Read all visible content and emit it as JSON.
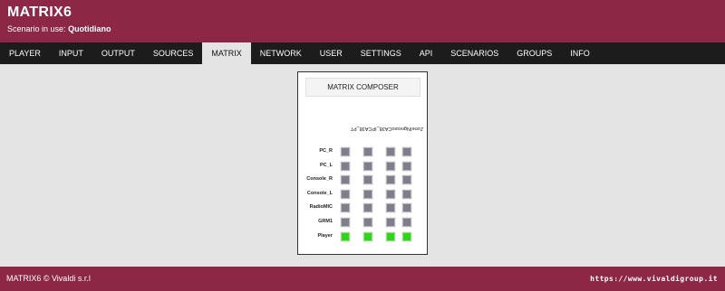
{
  "header": {
    "app_title": "MATRIX6",
    "scenario_label": "Scenario in use:",
    "scenario_value": "Quotidiano"
  },
  "nav": {
    "items": [
      {
        "label": "PLAYER"
      },
      {
        "label": "INPUT"
      },
      {
        "label": "OUTPUT"
      },
      {
        "label": "SOURCES"
      },
      {
        "label": "MATRIX",
        "active": true
      },
      {
        "label": "NETWORK"
      },
      {
        "label": "USER"
      },
      {
        "label": "SETTINGS"
      },
      {
        "label": "API"
      },
      {
        "label": "SCENARIOS"
      },
      {
        "label": "GROUPS"
      },
      {
        "label": "INFO"
      }
    ]
  },
  "matrix": {
    "composer_label": "MATRIX COMPOSER",
    "column_header": "ZoneINgressoCA38_IPCA38_PT",
    "rows": [
      {
        "label": "PC_R",
        "states": [
          false,
          false,
          false,
          false
        ]
      },
      {
        "label": "PC_L",
        "states": [
          false,
          false,
          false,
          false
        ]
      },
      {
        "label": "Console_R",
        "states": [
          false,
          false,
          false,
          false
        ]
      },
      {
        "label": "Console_L",
        "states": [
          false,
          false,
          false,
          false
        ]
      },
      {
        "label": "RadioMIC",
        "states": [
          false,
          false,
          false,
          false
        ]
      },
      {
        "label": "GRM1",
        "states": [
          false,
          false,
          false,
          false
        ]
      },
      {
        "label": "Player",
        "states": [
          true,
          true,
          true,
          true
        ]
      }
    ],
    "colors": {
      "active": "#32d21e",
      "inactive": "#7f7f8c"
    }
  },
  "footer": {
    "copyright": "MATRIX6 © Vivaldi s.r.l",
    "website": "https://www.vivaldigroup.it"
  },
  "colors": {
    "brand": "#8c2846",
    "nav_bg": "#1c1c1c",
    "page_bg": "#e4e4e4"
  }
}
